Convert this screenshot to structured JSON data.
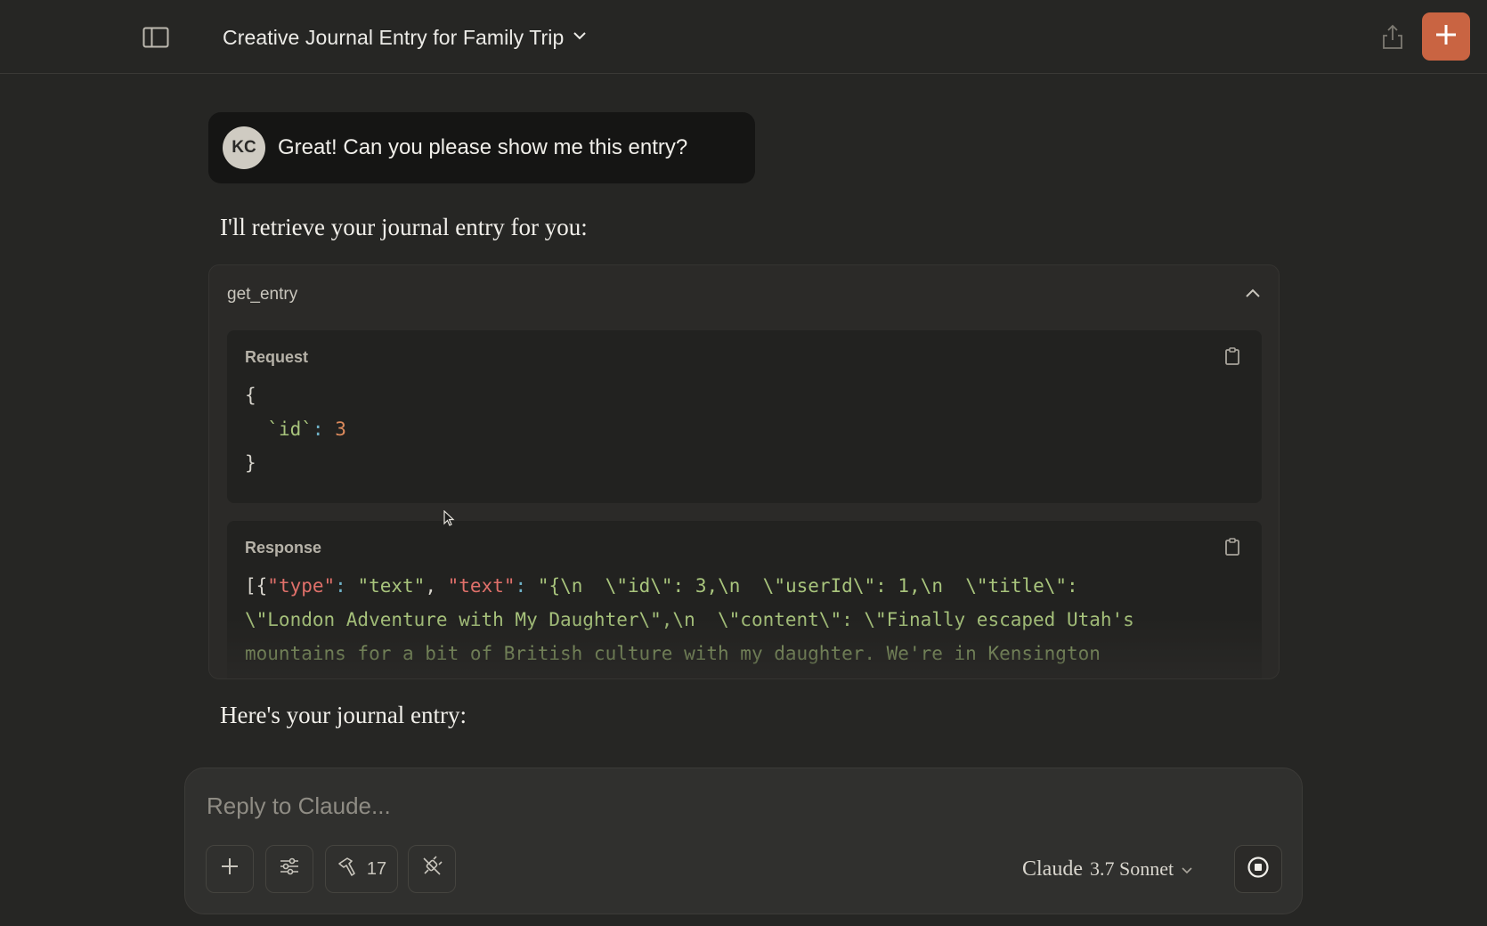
{
  "header": {
    "title": "Creative Journal Entry for Family Trip"
  },
  "user_message": {
    "avatar_initials": "KC",
    "text": "Great! Can you please show me this entry?"
  },
  "assistant": {
    "intro_text": "I'll retrieve your journal entry for you:",
    "after_text": "Here's your journal entry:"
  },
  "tool_call": {
    "name": "get_entry",
    "request_label": "Request",
    "request": {
      "open": "{",
      "key": "`id`",
      "colon": ":",
      "value": "3",
      "close": "}"
    },
    "response_label": "Response",
    "response": {
      "l1_open": "[{",
      "l1_type_key": "\"type\"",
      "l1_colon1": ":",
      "l1_type_val": "\"text\"",
      "l1_comma": ",",
      "l1_text_key": "\"text\"",
      "l1_colon2": ":",
      "l1_rest": "\"{\\n  \\\"id\\\": 3,\\n  \\\"userId\\\": 1,\\n  \\\"title\\\":",
      "l2": "\\\"London Adventure with My Daughter\\\",\\n  \\\"content\\\": \\\"Finally escaped Utah's",
      "l3": "mountains for a bit of British culture with my daughter. We're in Kensington"
    }
  },
  "composer": {
    "placeholder": "Reply to Claude...",
    "tools_count": "17",
    "model_name": "Claude",
    "model_version": "3.7 Sonnet"
  },
  "colors": {
    "accent": "#c96442",
    "background": "#262624",
    "string_green": "#a8c47c",
    "number_orange": "#dc8a5c",
    "key_red": "#e0706a"
  },
  "icons": {
    "sidebar_toggle": "sidebar-toggle-icon",
    "title_dropdown": "chevron-down-icon",
    "share": "share-icon",
    "new_chat": "plus-icon",
    "collapse": "chevron-up-icon",
    "copy": "clipboard-icon",
    "add": "plus-icon",
    "settings": "sliders-icon",
    "tools": "hammer-icon",
    "integrations": "plug-icon",
    "stop": "stop-icon"
  }
}
